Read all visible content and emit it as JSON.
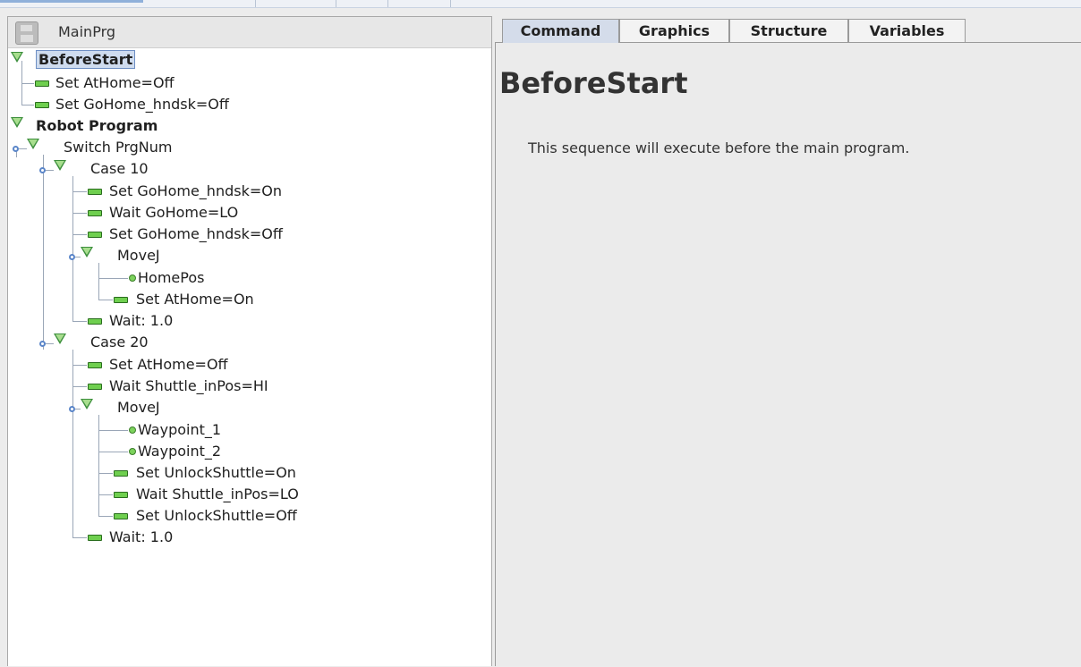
{
  "header": {
    "program_name": "MainPrg"
  },
  "tabs": [
    {
      "label": "Command",
      "active": true
    },
    {
      "label": "Graphics",
      "active": false
    },
    {
      "label": "Structure",
      "active": false
    },
    {
      "label": "Variables",
      "active": false
    }
  ],
  "tree": {
    "before_start": "BeforeStart",
    "bs_set_athome": "Set AtHome=Off",
    "bs_set_gohome": "Set GoHome_hndsk=Off",
    "robot_program": "Robot Program",
    "switch": "Switch PrgNum",
    "case10": "Case 10",
    "c10_set_gohome_on": "Set GoHome_hndsk=On",
    "c10_wait_gohome": "Wait GoHome=LO",
    "c10_set_gohome_off": "Set GoHome_hndsk=Off",
    "c10_movej": "MoveJ",
    "c10_homepos": "HomePos",
    "c10_set_athome_on": "Set AtHome=On",
    "c10_wait": "Wait: 1.0",
    "case20": "Case 20",
    "c20_set_athome_off": "Set AtHome=Off",
    "c20_wait_shuttle_hi": "Wait Shuttle_inPos=HI",
    "c20_movej": "MoveJ",
    "c20_wp1": "Waypoint_1",
    "c20_wp2": "Waypoint_2",
    "c20_set_unlock_on": "Set UnlockShuttle=On",
    "c20_wait_shuttle_lo": "Wait Shuttle_inPos=LO",
    "c20_set_unlock_off": "Set UnlockShuttle=Off",
    "c20_wait": "Wait: 1.0"
  },
  "content": {
    "title": "BeforeStart",
    "description": "This sequence will execute before the main program."
  },
  "colors": {
    "selection": "#cfdcef",
    "active_tab": "#d4dcea",
    "node_green": "#6fcf4f",
    "tree_line": "#9aa6b7"
  }
}
